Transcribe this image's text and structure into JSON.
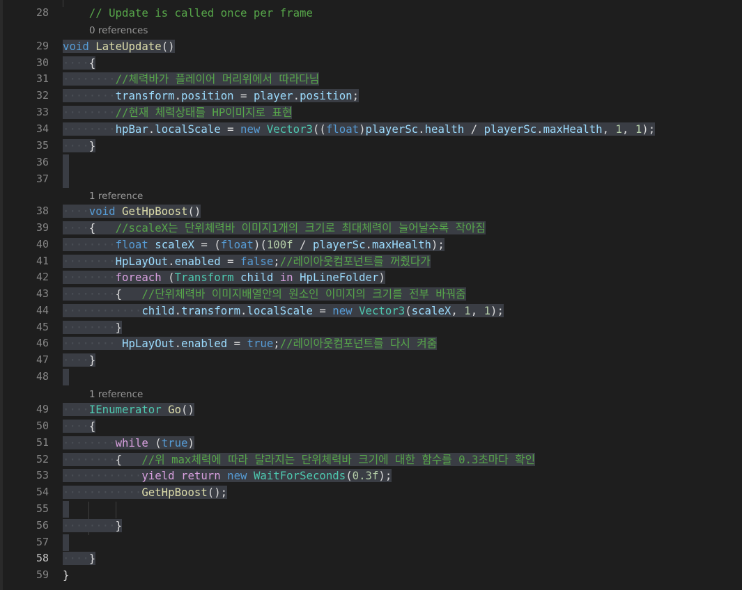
{
  "colors": {
    "background": "#1e1e1e",
    "selection": "#3a3d44",
    "line_number": "#858585",
    "keyword": "#569cd6",
    "control_keyword": "#d8a0df",
    "type": "#4ec9b0",
    "method": "#dcdcaa",
    "variable": "#9cdcfe",
    "number": "#b5cea8",
    "comment": "#57a64a"
  },
  "icons": {
    "lightbulb": "lightbulb-icon"
  },
  "code_lens": {
    "late_update": "0 references",
    "get_hp_boost": "1 reference",
    "go": "1 reference"
  },
  "lines": [
    {
      "number": "28",
      "tokens": [
        {
          "t": "    ",
          "c": "pl"
        },
        {
          "t": "// Update is called once per frame",
          "c": "cm"
        }
      ]
    },
    {
      "number": "29",
      "tokens": [
        {
          "t": "void",
          "c": "kw"
        },
        {
          "t": " ",
          "c": "pl"
        },
        {
          "t": "LateUpdate",
          "c": "fn"
        },
        {
          "t": "()",
          "c": "pl"
        }
      ]
    },
    {
      "number": "30",
      "tokens": [
        {
          "t": "····",
          "c": "ws"
        },
        {
          "t": "{",
          "c": "pl"
        }
      ]
    },
    {
      "number": "31",
      "tokens": [
        {
          "t": "········",
          "c": "ws"
        },
        {
          "t": "//체력바가 플레이어 머리위에서 따라다님",
          "c": "cm"
        }
      ]
    },
    {
      "number": "32",
      "tokens": [
        {
          "t": "········",
          "c": "ws"
        },
        {
          "t": "transform",
          "c": "var"
        },
        {
          "t": ".",
          "c": "pl"
        },
        {
          "t": "position",
          "c": "var"
        },
        {
          "t": " = ",
          "c": "pl"
        },
        {
          "t": "player",
          "c": "var"
        },
        {
          "t": ".",
          "c": "pl"
        },
        {
          "t": "position",
          "c": "var"
        },
        {
          "t": ";",
          "c": "pl"
        }
      ]
    },
    {
      "number": "33",
      "tokens": [
        {
          "t": "········",
          "c": "ws"
        },
        {
          "t": "//현재 체력상태를 HP이미지로 표현",
          "c": "cm"
        }
      ]
    },
    {
      "number": "34",
      "tokens": [
        {
          "t": "········",
          "c": "ws"
        },
        {
          "t": "hpBar",
          "c": "var"
        },
        {
          "t": ".",
          "c": "pl"
        },
        {
          "t": "localScale",
          "c": "var"
        },
        {
          "t": " = ",
          "c": "pl"
        },
        {
          "t": "new",
          "c": "kw"
        },
        {
          "t": " ",
          "c": "pl"
        },
        {
          "t": "Vector3",
          "c": "ty"
        },
        {
          "t": "((",
          "c": "pl"
        },
        {
          "t": "float",
          "c": "kw"
        },
        {
          "t": ")",
          "c": "pl"
        },
        {
          "t": "playerSc",
          "c": "var"
        },
        {
          "t": ".",
          "c": "pl"
        },
        {
          "t": "health",
          "c": "var"
        },
        {
          "t": " / ",
          "c": "pl"
        },
        {
          "t": "playerSc",
          "c": "var"
        },
        {
          "t": ".",
          "c": "pl"
        },
        {
          "t": "maxHealth",
          "c": "var"
        },
        {
          "t": ", ",
          "c": "pl"
        },
        {
          "t": "1",
          "c": "num"
        },
        {
          "t": ", ",
          "c": "pl"
        },
        {
          "t": "1",
          "c": "num"
        },
        {
          "t": ");",
          "c": "pl"
        }
      ]
    },
    {
      "number": "35",
      "tokens": [
        {
          "t": "····",
          "c": "ws"
        },
        {
          "t": "}",
          "c": "pl"
        }
      ]
    },
    {
      "number": "36",
      "tokens": []
    },
    {
      "number": "37",
      "tokens": []
    },
    {
      "number": "38",
      "tokens": [
        {
          "t": "····",
          "c": "ws"
        },
        {
          "t": "void",
          "c": "kw"
        },
        {
          "t": " ",
          "c": "pl"
        },
        {
          "t": "GetHpBoost",
          "c": "fn"
        },
        {
          "t": "()",
          "c": "pl"
        }
      ]
    },
    {
      "number": "39",
      "tokens": [
        {
          "t": "····",
          "c": "ws"
        },
        {
          "t": "{   ",
          "c": "pl"
        },
        {
          "t": "//scaleX는 단위체력바 이미지1개의 크기로 최대체력이 늘어날수록 작아짐",
          "c": "cm"
        }
      ]
    },
    {
      "number": "40",
      "tokens": [
        {
          "t": "········",
          "c": "ws"
        },
        {
          "t": "float",
          "c": "kw"
        },
        {
          "t": " ",
          "c": "pl"
        },
        {
          "t": "scaleX",
          "c": "var"
        },
        {
          "t": " = (",
          "c": "pl"
        },
        {
          "t": "float",
          "c": "kw"
        },
        {
          "t": ")(",
          "c": "pl"
        },
        {
          "t": "100f",
          "c": "num"
        },
        {
          "t": " / ",
          "c": "pl"
        },
        {
          "t": "playerSc",
          "c": "var"
        },
        {
          "t": ".",
          "c": "pl"
        },
        {
          "t": "maxHealth",
          "c": "var"
        },
        {
          "t": ");",
          "c": "pl"
        }
      ]
    },
    {
      "number": "41",
      "tokens": [
        {
          "t": "········",
          "c": "ws"
        },
        {
          "t": "HpLayOut",
          "c": "var"
        },
        {
          "t": ".",
          "c": "pl"
        },
        {
          "t": "enabled",
          "c": "var"
        },
        {
          "t": " = ",
          "c": "pl"
        },
        {
          "t": "false",
          "c": "kw"
        },
        {
          "t": ";",
          "c": "pl"
        },
        {
          "t": "//레이아웃컴포넌트를 꺼줬다가",
          "c": "cm"
        }
      ]
    },
    {
      "number": "42",
      "tokens": [
        {
          "t": "········",
          "c": "ws"
        },
        {
          "t": "foreach",
          "c": "ctl"
        },
        {
          "t": " (",
          "c": "pl"
        },
        {
          "t": "Transform",
          "c": "ty"
        },
        {
          "t": " ",
          "c": "pl"
        },
        {
          "t": "child",
          "c": "var"
        },
        {
          "t": " ",
          "c": "pl"
        },
        {
          "t": "in",
          "c": "ctl"
        },
        {
          "t": " ",
          "c": "pl"
        },
        {
          "t": "HpLineFolder",
          "c": "var"
        },
        {
          "t": ")",
          "c": "pl"
        }
      ]
    },
    {
      "number": "43",
      "tokens": [
        {
          "t": "········",
          "c": "ws"
        },
        {
          "t": "{   ",
          "c": "pl"
        },
        {
          "t": "//단위체력바 이미지배열안의 원소인 이미지의 크기를 전부 바꿔줌",
          "c": "cm"
        }
      ]
    },
    {
      "number": "44",
      "tokens": [
        {
          "t": "············",
          "c": "ws"
        },
        {
          "t": "child",
          "c": "var"
        },
        {
          "t": ".",
          "c": "pl"
        },
        {
          "t": "transform",
          "c": "var"
        },
        {
          "t": ".",
          "c": "pl"
        },
        {
          "t": "localScale",
          "c": "var"
        },
        {
          "t": " = ",
          "c": "pl"
        },
        {
          "t": "new",
          "c": "kw"
        },
        {
          "t": " ",
          "c": "pl"
        },
        {
          "t": "Vector3",
          "c": "ty"
        },
        {
          "t": "(",
          "c": "pl"
        },
        {
          "t": "scaleX",
          "c": "var"
        },
        {
          "t": ", ",
          "c": "pl"
        },
        {
          "t": "1",
          "c": "num"
        },
        {
          "t": ", ",
          "c": "pl"
        },
        {
          "t": "1",
          "c": "num"
        },
        {
          "t": ");",
          "c": "pl"
        }
      ]
    },
    {
      "number": "45",
      "tokens": [
        {
          "t": "········",
          "c": "ws"
        },
        {
          "t": "}",
          "c": "pl"
        }
      ]
    },
    {
      "number": "46",
      "tokens": [
        {
          "t": "········",
          "c": "ws"
        },
        {
          "t": " HpLayOut",
          "c": "var"
        },
        {
          "t": ".",
          "c": "pl"
        },
        {
          "t": "enabled",
          "c": "var"
        },
        {
          "t": " = ",
          "c": "pl"
        },
        {
          "t": "true",
          "c": "kw"
        },
        {
          "t": ";",
          "c": "pl"
        },
        {
          "t": "//레이아웃컴포넌트를 다시 켜줌",
          "c": "cm"
        }
      ]
    },
    {
      "number": "47",
      "tokens": [
        {
          "t": "····",
          "c": "ws"
        },
        {
          "t": "}",
          "c": "pl"
        }
      ]
    },
    {
      "number": "48",
      "tokens": []
    },
    {
      "number": "49",
      "tokens": [
        {
          "t": "····",
          "c": "ws"
        },
        {
          "t": "IEnumerator",
          "c": "ty"
        },
        {
          "t": " ",
          "c": "pl"
        },
        {
          "t": "Go",
          "c": "fn"
        },
        {
          "t": "()",
          "c": "pl"
        }
      ]
    },
    {
      "number": "50",
      "tokens": [
        {
          "t": "····",
          "c": "ws"
        },
        {
          "t": "{",
          "c": "pl"
        }
      ]
    },
    {
      "number": "51",
      "tokens": [
        {
          "t": "········",
          "c": "ws"
        },
        {
          "t": "while",
          "c": "ctl"
        },
        {
          "t": " (",
          "c": "pl"
        },
        {
          "t": "true",
          "c": "kw"
        },
        {
          "t": ")",
          "c": "pl"
        }
      ]
    },
    {
      "number": "52",
      "tokens": [
        {
          "t": "········",
          "c": "ws"
        },
        {
          "t": "{   ",
          "c": "pl"
        },
        {
          "t": "//위 max체력에 따라 달라지는 단위체력바 크기에 대한 함수를 0.3초마다 확인",
          "c": "cm"
        }
      ]
    },
    {
      "number": "53",
      "tokens": [
        {
          "t": "············",
          "c": "ws"
        },
        {
          "t": "yield",
          "c": "ctl"
        },
        {
          "t": " ",
          "c": "pl"
        },
        {
          "t": "return",
          "c": "ctl"
        },
        {
          "t": " ",
          "c": "pl"
        },
        {
          "t": "new",
          "c": "kw"
        },
        {
          "t": " ",
          "c": "pl"
        },
        {
          "t": "WaitForSeconds",
          "c": "ty"
        },
        {
          "t": "(",
          "c": "pl"
        },
        {
          "t": "0.3f",
          "c": "num"
        },
        {
          "t": ");",
          "c": "pl"
        }
      ]
    },
    {
      "number": "54",
      "tokens": [
        {
          "t": "············",
          "c": "ws"
        },
        {
          "t": "GetHpBoost",
          "c": "fn"
        },
        {
          "t": "();",
          "c": "pl"
        }
      ]
    },
    {
      "number": "55",
      "tokens": []
    },
    {
      "number": "56",
      "tokens": [
        {
          "t": "········",
          "c": "ws"
        },
        {
          "t": "}",
          "c": "pl"
        }
      ]
    },
    {
      "number": "57",
      "tokens": []
    },
    {
      "number": "58",
      "current": true,
      "tokens": [
        {
          "t": "····",
          "c": "ws"
        },
        {
          "t": "}",
          "c": "pl"
        }
      ]
    },
    {
      "number": "59",
      "tokens": [
        {
          "t": "}",
          "c": "pl"
        }
      ]
    }
  ]
}
